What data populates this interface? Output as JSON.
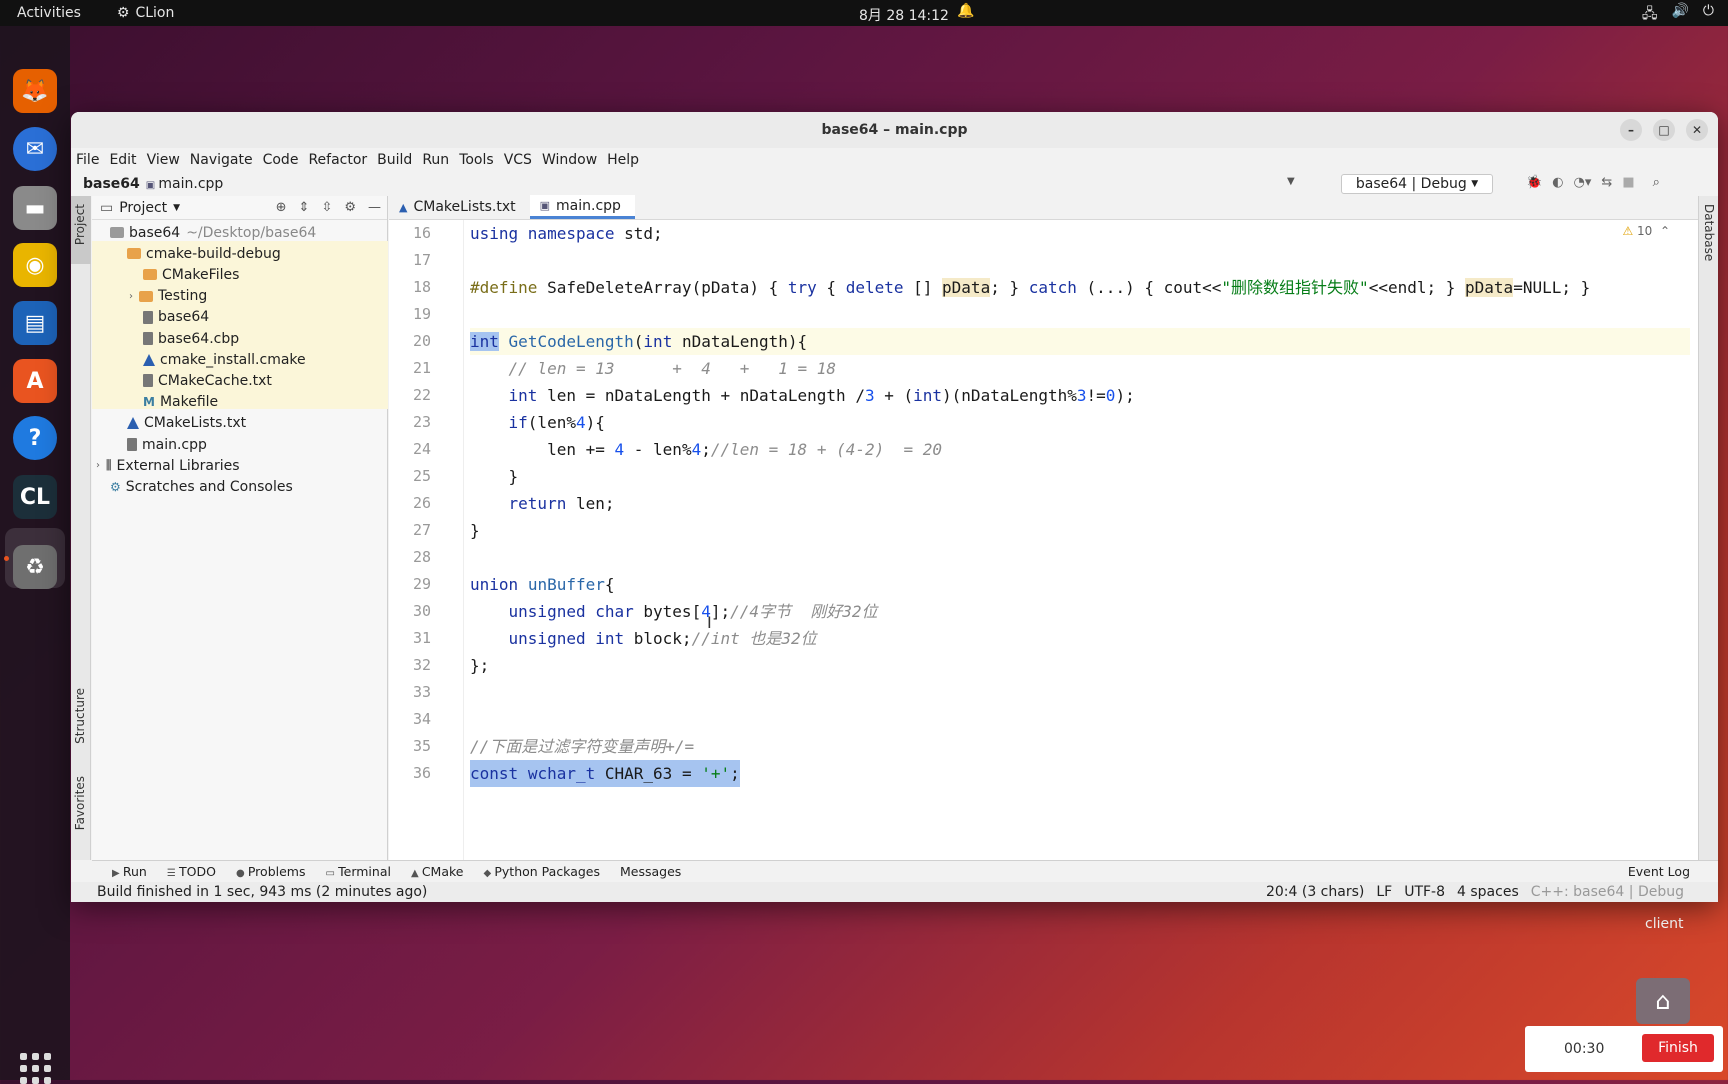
{
  "topbar": {
    "activities": "Activities",
    "app": "CLion",
    "clock": "8月 28  14:12"
  },
  "dock": [
    {
      "name": "firefox-icon",
      "glyph": "🦊",
      "color": "#e66000"
    },
    {
      "name": "thunderbird-icon",
      "glyph": "✉",
      "color": "#2a6fd6"
    },
    {
      "name": "files-icon",
      "glyph": "▬",
      "color": "#8a8a8a"
    },
    {
      "name": "rhythmbox-icon",
      "glyph": "◉",
      "color": "#e9b500"
    },
    {
      "name": "writer-icon",
      "glyph": "▤",
      "color": "#1d63b8"
    },
    {
      "name": "software-icon",
      "glyph": "A",
      "color": "#e95420"
    },
    {
      "name": "help-icon",
      "glyph": "?",
      "color": "#1f7ae0"
    },
    {
      "name": "clion-icon",
      "glyph": "CL",
      "color": "#1c2f3a"
    },
    {
      "name": "trash-icon",
      "glyph": "♻",
      "color": "#6f6f6f"
    }
  ],
  "window": {
    "title": "base64 – main.cpp"
  },
  "menu": [
    "File",
    "Edit",
    "View",
    "Navigate",
    "Code",
    "Refactor",
    "Build",
    "Run",
    "Tools",
    "VCS",
    "Window",
    "Help"
  ],
  "nav": {
    "project": "base64",
    "file": "main.cpp",
    "run_config": "base64 | Debug"
  },
  "project_panel": {
    "title": "Project",
    "items": [
      {
        "label": "base64",
        "hint": "~/Desktop/base64",
        "indent": 0,
        "icon": "folder gray"
      },
      {
        "label": "cmake-build-debug",
        "indent": 1,
        "icon": "folder"
      },
      {
        "label": "CMakeFiles",
        "indent": 2,
        "icon": "folder"
      },
      {
        "label": "Testing",
        "indent": 2,
        "icon": "folder",
        "caret": "›"
      },
      {
        "label": "base64",
        "indent": 2,
        "icon": "file"
      },
      {
        "label": "base64.cbp",
        "indent": 2,
        "icon": "file"
      },
      {
        "label": "cmake_install.cmake",
        "indent": 2,
        "icon": "cmk"
      },
      {
        "label": "CMakeCache.txt",
        "indent": 2,
        "icon": "file"
      },
      {
        "label": "Makefile",
        "indent": 2,
        "icon": "mk"
      },
      {
        "label": "CMakeLists.txt",
        "indent": 1,
        "icon": "cmk"
      },
      {
        "label": "main.cpp",
        "indent": 1,
        "icon": "file"
      },
      {
        "label": "External Libraries",
        "indent": 0,
        "icon": "lib",
        "caret": "›"
      },
      {
        "label": "Scratches and Consoles",
        "indent": 0,
        "icon": "scratch"
      }
    ]
  },
  "side_tabs": {
    "project": "Project",
    "structure": "Structure",
    "favorites": "Favorites",
    "database": "Database"
  },
  "editor_tabs": [
    {
      "label": "CMakeLists.txt",
      "active": false
    },
    {
      "label": "main.cpp",
      "active": true
    }
  ],
  "warnings": "10",
  "line_numbers": [
    "16",
    "17",
    "18",
    "19",
    "20",
    "21",
    "22",
    "23",
    "24",
    "25",
    "26",
    "27",
    "28",
    "29",
    "30",
    "31",
    "32",
    "33",
    "34",
    "35",
    "36"
  ],
  "bottom_tabs": [
    "Run",
    "TODO",
    "Problems",
    "Terminal",
    "CMake",
    "Python Packages",
    "Messages"
  ],
  "event_log": "Event Log",
  "status": {
    "message": "Build finished in 1 sec, 943 ms (2 minutes ago)",
    "position": "20:4 (3 chars)",
    "line_sep": "LF",
    "encoding": "UTF-8",
    "indent": "4 spaces",
    "context": "C++: base64 | Debug"
  },
  "desktop": {
    "client_label": "client"
  },
  "timer": {
    "time": "00:30",
    "finish": "Finish"
  }
}
